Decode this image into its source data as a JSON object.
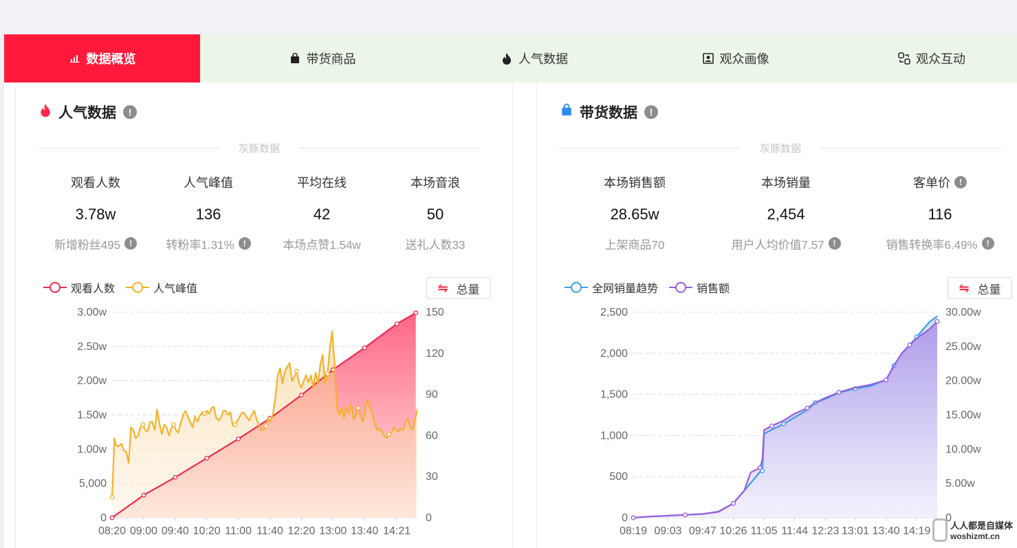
{
  "tabs": [
    {
      "label": "数据概览",
      "icon": "bar-chart-icon",
      "active": true
    },
    {
      "label": "带货商品",
      "icon": "shopping-bag-icon",
      "active": false
    },
    {
      "label": "人气数据",
      "icon": "flame-icon",
      "active": false
    },
    {
      "label": "观众画像",
      "icon": "user-portrait-icon",
      "active": false
    },
    {
      "label": "观众互动",
      "icon": "interaction-icon",
      "active": false
    }
  ],
  "popularity": {
    "title": "人气数据",
    "subtitle": "灰豚数据",
    "stats": [
      {
        "label": "观看人数",
        "value": "3.78w",
        "sub": "新增粉丝495",
        "sub_help": true
      },
      {
        "label": "人气峰值",
        "value": "136",
        "sub": "转粉率1.31%",
        "sub_help": true
      },
      {
        "label": "平均在线",
        "value": "42",
        "sub": "本场点赞1.54w",
        "sub_help": false
      },
      {
        "label": "本场音浪",
        "value": "50",
        "sub": "送礼人数33",
        "sub_help": false
      }
    ],
    "legend": [
      "观看人数",
      "人气峰值"
    ],
    "total_button": "总量"
  },
  "sales": {
    "title": "带货数据",
    "subtitle": "灰豚数据",
    "stats": [
      {
        "label": "本场销售额",
        "value": "28.65w",
        "sub": "上架商品70",
        "sub_help": false,
        "label_help": false
      },
      {
        "label": "本场销量",
        "value": "2,454",
        "sub": "用户人均价值7.57",
        "sub_help": true,
        "label_help": false
      },
      {
        "label": "客单价",
        "value": "116",
        "sub": "销售转换率6.49%",
        "sub_help": true,
        "label_help": true
      }
    ],
    "legend": [
      "全网销量趋势",
      "销售额"
    ],
    "total_button": "总量"
  },
  "colors": {
    "accent": "#ff1a3c",
    "viewers": "#ee2a50",
    "peak": "#f4b22a",
    "trend": "#3aa0e8",
    "sales": "#9a5ce0"
  },
  "watermark": {
    "line1": "人人都是自媒体",
    "line2": "woshizmt.cn"
  },
  "chart_data": [
    {
      "type": "area",
      "x_tick_labels": [
        "08:20",
        "09:00",
        "09:40",
        "10:20",
        "11:00",
        "11:40",
        "12:20",
        "13:00",
        "13:40",
        "14:21"
      ],
      "y_left_ticks": [
        "0",
        "5,000",
        "1.00w",
        "1.50w",
        "2.00w",
        "2.50w",
        "3.00w"
      ],
      "y_right_ticks": [
        "0",
        "30",
        "60",
        "90",
        "120",
        "150"
      ],
      "ylim_left": [
        0,
        30000
      ],
      "ylim_right": [
        0,
        150
      ],
      "grid": true,
      "legend_position": "top-left",
      "series": [
        {
          "name": "观看人数",
          "axis": "left",
          "color": "#ee2a50",
          "x": [
            "08:20",
            "09:00",
            "09:40",
            "10:20",
            "11:00",
            "11:40",
            "12:20",
            "13:00",
            "13:40",
            "14:21",
            "14:45"
          ],
          "values": [
            0,
            3300,
            5900,
            8700,
            11500,
            14500,
            17900,
            21600,
            24800,
            28300,
            29900
          ]
        },
        {
          "name": "人气峰值",
          "axis": "right",
          "color": "#f4b22a",
          "x": [
            "08:20",
            "08:23",
            "08:25",
            "08:28",
            "08:32",
            "08:35",
            "08:38",
            "08:41",
            "08:44",
            "08:47",
            "08:50",
            "08:53",
            "08:56",
            "08:59",
            "09:02",
            "09:05",
            "09:08",
            "09:11",
            "09:14",
            "09:17",
            "09:20",
            "09:23",
            "09:26",
            "09:29",
            "09:32",
            "09:35",
            "09:38",
            "09:41",
            "09:44",
            "09:47",
            "09:50",
            "09:53",
            "09:56",
            "09:59",
            "10:02",
            "10:05",
            "10:08",
            "10:11",
            "10:14",
            "10:17",
            "10:20",
            "10:23",
            "10:26",
            "10:29",
            "10:32",
            "10:35",
            "10:38",
            "10:41",
            "10:44",
            "10:47",
            "10:50",
            "10:53",
            "10:56",
            "10:59",
            "11:02",
            "11:05",
            "11:08",
            "11:11",
            "11:14",
            "11:17",
            "11:20",
            "11:23",
            "11:26",
            "11:29",
            "11:32",
            "11:35",
            "11:38",
            "11:41",
            "11:44",
            "11:47",
            "11:50",
            "11:53",
            "11:56",
            "11:59",
            "12:02",
            "12:05",
            "12:08",
            "12:11",
            "12:14",
            "12:17",
            "12:20",
            "12:23",
            "12:26",
            "12:29",
            "12:32",
            "12:35",
            "12:38",
            "12:41",
            "12:44",
            "12:47",
            "12:50",
            "12:53",
            "12:56",
            "12:59",
            "13:02",
            "13:05",
            "13:08",
            "13:11",
            "13:14",
            "13:17",
            "13:20",
            "13:23",
            "13:26",
            "13:29",
            "13:32",
            "13:35",
            "13:38",
            "13:41",
            "13:44",
            "13:47",
            "13:50",
            "13:53",
            "13:56",
            "13:59",
            "14:02",
            "14:05",
            "14:08",
            "14:11",
            "14:14",
            "14:17",
            "14:20",
            "14:23",
            "14:26",
            "14:29",
            "14:32",
            "14:35",
            "14:38",
            "14:41",
            "14:44",
            "14:47"
          ],
          "values": [
            15,
            58,
            53,
            52,
            54,
            49,
            48,
            40,
            66,
            64,
            58,
            60,
            66,
            68,
            64,
            63,
            70,
            70,
            64,
            79,
            69,
            61,
            68,
            66,
            60,
            65,
            68,
            64,
            62,
            69,
            75,
            78,
            74,
            70,
            66,
            74,
            70,
            74,
            77,
            76,
            78,
            76,
            80,
            81,
            73,
            71,
            73,
            78,
            78,
            75,
            77,
            67,
            68,
            71,
            74,
            77,
            76,
            73,
            71,
            75,
            78,
            72,
            68,
            64,
            64,
            67,
            73,
            70,
            76,
            88,
            104,
            109,
            98,
            107,
            110,
            113,
            100,
            103,
            107,
            98,
            95,
            100,
            104,
            99,
            104,
            95,
            106,
            98,
            112,
            119,
            98,
            105,
            124,
            136,
            113,
            80,
            75,
            80,
            73,
            81,
            76,
            83,
            72,
            75,
            80,
            74,
            70,
            79,
            86,
            80,
            75,
            69,
            64,
            65,
            63,
            60,
            58,
            61,
            62,
            66,
            64,
            63,
            65,
            64,
            70,
            72,
            66,
            64,
            72,
            79
          ]
        }
      ]
    },
    {
      "type": "area",
      "x_tick_labels": [
        "08:19",
        "09:03",
        "09:47",
        "10:26",
        "11:05",
        "11:44",
        "12:23",
        "13:01",
        "13:40",
        "14:19"
      ],
      "y_left_ticks": [
        "0",
        "500",
        "1,000",
        "1,500",
        "2,000",
        "2,500"
      ],
      "y_right_ticks": [
        "0",
        "5.00w",
        "10.00w",
        "15.00w",
        "20.00w",
        "25.00w",
        "30.00w"
      ],
      "ylim_left": [
        0,
        2500
      ],
      "ylim_right": [
        0,
        300000
      ],
      "grid": true,
      "legend_position": "top-left",
      "series": [
        {
          "name": "全网销量趋势",
          "axis": "left",
          "color": "#3aa0e8",
          "x": [
            "08:19",
            "08:40",
            "09:03",
            "09:25",
            "09:47",
            "10:07",
            "10:26",
            "10:40",
            "11:00",
            "11:03",
            "11:05",
            "11:15",
            "11:30",
            "11:44",
            "12:00",
            "12:10",
            "12:23",
            "12:40",
            "13:01",
            "13:20",
            "13:40",
            "13:50",
            "14:00",
            "14:10",
            "14:19",
            "14:35",
            "14:45"
          ],
          "values": [
            0,
            15,
            25,
            35,
            45,
            75,
            175,
            330,
            560,
            570,
            1020,
            1070,
            1140,
            1220,
            1310,
            1400,
            1445,
            1520,
            1570,
            1600,
            1680,
            1850,
            2000,
            2100,
            2200,
            2380,
            2450
          ]
        },
        {
          "name": "销售额",
          "axis": "right",
          "color": "#9a5ce0",
          "x": [
            "08:19",
            "08:40",
            "09:03",
            "09:25",
            "09:47",
            "10:07",
            "10:26",
            "10:40",
            "10:48",
            "11:00",
            "11:03",
            "11:05",
            "11:15",
            "11:30",
            "11:44",
            "12:00",
            "12:10",
            "12:23",
            "12:40",
            "13:01",
            "13:20",
            "13:40",
            "13:50",
            "14:00",
            "14:10",
            "14:19",
            "14:35",
            "14:45"
          ],
          "values": [
            0,
            1800,
            3000,
            4200,
            5500,
            8500,
            21000,
            40000,
            66000,
            73000,
            86000,
            128000,
            134000,
            142000,
            152000,
            160000,
            168000,
            175000,
            183000,
            190000,
            194000,
            201000,
            222000,
            240000,
            252000,
            262000,
            275000,
            286500
          ]
        }
      ]
    }
  ]
}
